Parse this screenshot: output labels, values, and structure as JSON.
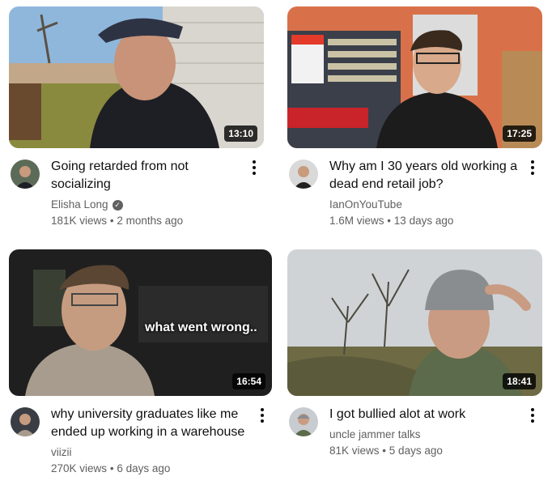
{
  "videos": [
    {
      "title": "Going retarded from not socializing",
      "channel": "Elisha Long",
      "verified": true,
      "views": "181K views",
      "age": "2 months ago",
      "duration": "13:10"
    },
    {
      "title": "Why am I 30 years old working a dead end retail job?",
      "channel": "IanOnYouTube",
      "verified": false,
      "views": "1.6M views",
      "age": "13 days ago",
      "duration": "17:25"
    },
    {
      "title": "why university graduates like me ended up working in a warehouse",
      "channel": "viizii",
      "verified": false,
      "views": "270K views",
      "age": "6 days ago",
      "duration": "16:54",
      "overlay_text": "what went wrong.."
    },
    {
      "title": "I got bullied alot at work",
      "channel": "uncle jammer talks",
      "verified": false,
      "views": "81K views",
      "age": "5 days ago",
      "duration": "18:41"
    }
  ],
  "separator": "•",
  "icons": {
    "verified": "verified-check-icon",
    "menu": "more-vert-icon"
  }
}
